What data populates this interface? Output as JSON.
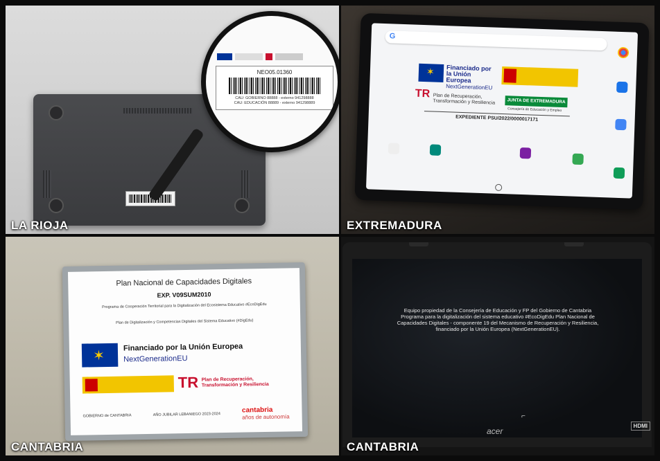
{
  "panels": [
    {
      "region": "LA RIOJA",
      "sticker": {
        "code": "NEO05.01360",
        "cau_lines": [
          "CAU: GOBIERNO 88888 - externo 941298888",
          "CAU: EDUCACIÓN 88889 - externo 941298889"
        ]
      }
    },
    {
      "region": "EXTREMADURA",
      "tablet": {
        "search_logo": "G",
        "eu_line1": "Financiado por",
        "eu_line2": "la Unión Europea",
        "eu_line3": "NextGenerationEU",
        "tr_line1": "Plan de Recuperación,",
        "tr_line2": "Transformación y Resiliencia",
        "junta": "JUNTA DE EXTREMADURA",
        "junta_sub": "Consejería de Educación y Empleo",
        "expediente": "EXPEDIENTE PSU/2022/0000017171"
      }
    },
    {
      "region": "CANTABRIA",
      "plaque": {
        "title": "Plan Nacional de Capacidades Digitales",
        "exp": "EXP. V09SUM2010",
        "programa": "Programa de Cooperación Territorial para la Digitalización del Ecosistema Educativo #EcoDigEdu",
        "plan": "Plan de Digitalización y Competencias Digitales del Sistema Educativo (#DigEdu)",
        "financiado": "Financiado por la Unión Europea",
        "ngeu": "NextGenerationEU",
        "tr_line1": "Plan de Recuperación,",
        "tr_line2": "Transformación y Resiliencia",
        "gobierno": "GOBIERNO de CANTABRIA",
        "jubilar": "AÑO JUBILAR LEBANIEGO 2023-2024",
        "cantabria": "cantabria",
        "anos": "años de autonomía"
      }
    },
    {
      "region": "CANTABRIA",
      "laptop": {
        "screen_text": "Equipo propiedad de la Consejería de Educación y FP del Gobierno de Cantabria Programa para la digitalización del sistema educativo #EcoDigEdu Plan Nacional de Capacidades Digitales - componente 19 del Mecanismo de Recuperación y Resiliencia, financiado por la Unión Europea (NextGenerationEU).",
        "brand": "acer",
        "port": "HDMI"
      }
    }
  ],
  "colors": {
    "eu_blue": "#003399",
    "eu_yellow": "#ffcc00",
    "spain_yellow": "#f2c500",
    "tr_red": "#c8102e",
    "junta_green": "#0a8a3a"
  }
}
